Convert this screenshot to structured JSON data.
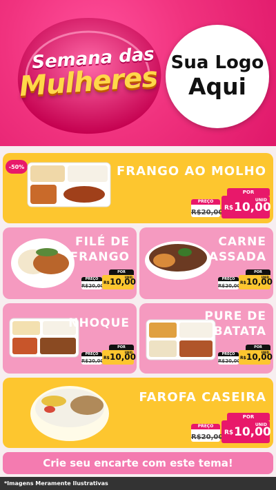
{
  "header": {
    "title_line1": "Semana das",
    "title_line2": "Mulheres",
    "logo_line1": "Sua Logo",
    "logo_line2": "Aqui"
  },
  "products": [
    {
      "name_line1": "FRANGO AO MOLHO",
      "name_line2": "",
      "badge": "-50%",
      "price_label": "PREÇO",
      "old_price": "R$20,00",
      "por_label": "POR",
      "currency": "R$",
      "new_price": "10,00",
      "unit_label": "UNID"
    },
    {
      "name_line1": "FILÉ DE",
      "name_line2": "FRANGO",
      "price_label": "PREÇO",
      "old_price": "R$20,00",
      "por_label": "POR",
      "currency": "R$",
      "new_price": "10,00",
      "unit_label": "UNID"
    },
    {
      "name_line1": "CARNE",
      "name_line2": "ASSADA",
      "price_label": "PREÇO",
      "old_price": "R$20,00",
      "por_label": "POR",
      "currency": "R$",
      "new_price": "10,00",
      "unit_label": "UNID"
    },
    {
      "name_line1": "NHOQUE",
      "name_line2": "",
      "price_label": "PREÇO",
      "old_price": "R$20,00",
      "por_label": "POR",
      "currency": "R$",
      "new_price": "10,00",
      "unit_label": "UNID"
    },
    {
      "name_line1": "PURE DE",
      "name_line2": "BATATA",
      "price_label": "PREÇO",
      "old_price": "R$20,00",
      "por_label": "POR",
      "currency": "R$",
      "new_price": "10,00",
      "unit_label": "UNID"
    },
    {
      "name_line1": "FAROFA CASEIRA",
      "name_line2": "",
      "price_label": "PREÇO",
      "old_price": "R$20,00",
      "por_label": "POR",
      "currency": "R$",
      "new_price": "10,00",
      "unit_label": "UNID"
    }
  ],
  "cta": "Crie seu encarte com este tema!",
  "footer_note": "*Imagens Meramente Ilustrativas",
  "colors": {
    "pink": "#e8186a",
    "yellow": "#fdc62f",
    "light_pink": "#f59ac0"
  }
}
